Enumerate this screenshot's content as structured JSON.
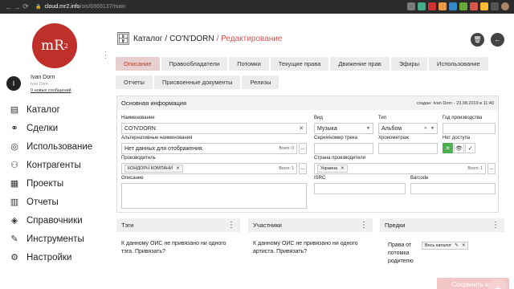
{
  "browser": {
    "back_icon": "←",
    "forward_icon": "→",
    "reload_icon": "⟳",
    "host": "cloud.mr2.info",
    "path": "/ois/6969137/main"
  },
  "sidebar": {
    "logo_text": "mR",
    "logo_sup": "2",
    "user_initial": "I",
    "user_name": "Ivan Dorn",
    "user_sub": "Ivan Dorn",
    "messages_link": "0 новых сообщений",
    "items": [
      {
        "label": "Каталог",
        "icon": "▤"
      },
      {
        "label": "Сделки",
        "icon": "⚭"
      },
      {
        "label": "Использование",
        "icon": "◎"
      },
      {
        "label": "Контрагенты",
        "icon": "⚇"
      },
      {
        "label": "Проекты",
        "icon": "▦"
      },
      {
        "label": "Отчеты",
        "icon": "▥"
      },
      {
        "label": "Справочники",
        "icon": "◈"
      },
      {
        "label": "Инструменты",
        "icon": "✎"
      },
      {
        "label": "Настройки",
        "icon": "⚙"
      }
    ]
  },
  "header": {
    "crumb_catalog": "Каталог",
    "sep": "/",
    "crumb_item": "CO'N'DORN",
    "crumb_edit": "/ Редактирование",
    "delete_icon": "🗑",
    "back_icon": "←"
  },
  "tabs": [
    "Описание",
    "Правообладатели",
    "Потомки",
    "Текущие права",
    "Движение прав",
    "Эфиры",
    "Использование",
    "Отчеты",
    "Присвоенные документы",
    "Релизы"
  ],
  "main_info": {
    "title": "Основная информация",
    "created": "создан: Ivan Dorn - 23.08.2019 в 11:40",
    "name_label": "Наименование",
    "name_value": "CO'N'DORN",
    "alt_label": "Альтернативные наименования",
    "alt_value": "Нет данных для отображения.",
    "alt_total": "Всего: 0",
    "producer_label": "Производитель",
    "producer_chip": "КОНДОРН КОМПАНИ",
    "producer_total": "Всего: 1",
    "desc_label": "Описание",
    "kind_label": "Вид",
    "kind_value": "Музыка",
    "type_label": "Тип",
    "type_value": "Альбом",
    "year_label": "Год производства",
    "series_label": "Серия/номер трека",
    "chrono_label": "Хронометраж",
    "noaccess_label": "Нет доступа",
    "country_label": "Страна производителя",
    "country_chip": "Украина",
    "country_total": "Всего: 1",
    "isrc_label": "ISRC",
    "barcode_label": "Barcode",
    "dots": "..."
  },
  "tags_panel": {
    "title": "Тэги",
    "text": "К данному ОИС не привязано ни одного тэга. Привязать?"
  },
  "members_panel": {
    "title": "Участники",
    "text": "К данному ОИС не привязано ни одного артиста. Привязать?"
  },
  "ancestors_panel": {
    "title": "Предки",
    "rights_label": "Права от потомка родителю",
    "chip": "Весь каталог"
  },
  "save_label": "Сохранить как",
  "fab_icon": "+"
}
